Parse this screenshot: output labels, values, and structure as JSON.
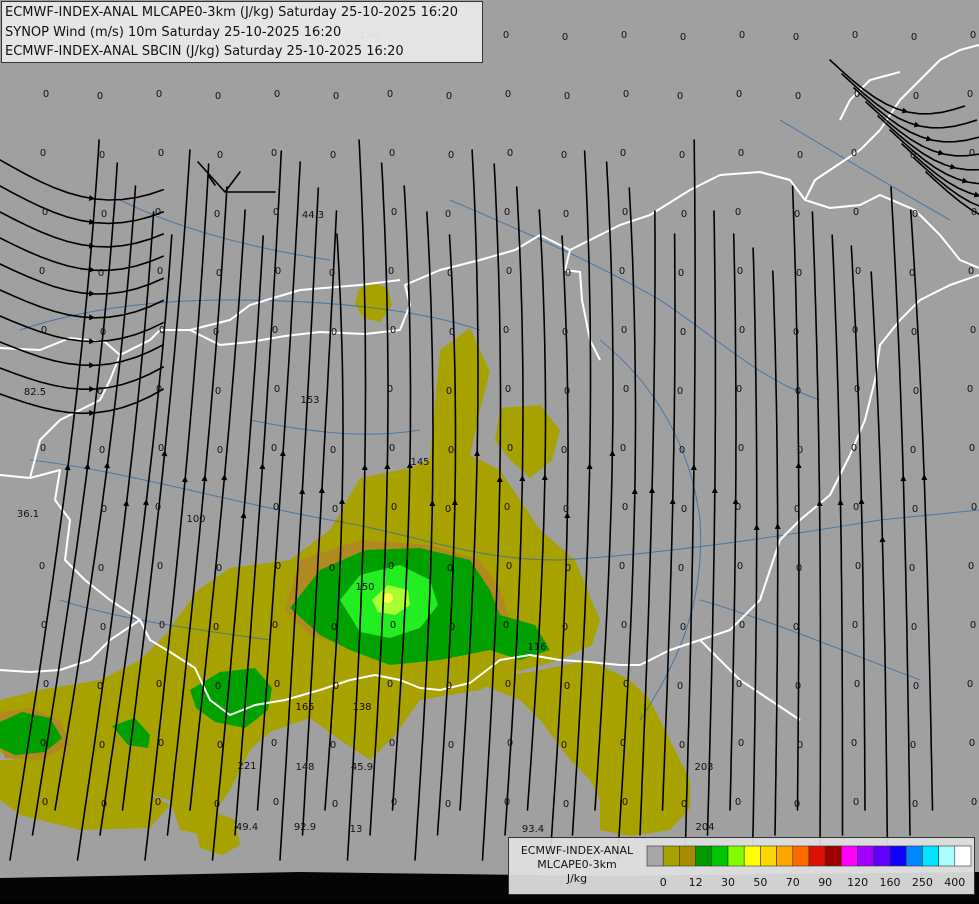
{
  "titles": [
    "ECMWF-INDEX-ANAL MLCAPE0-3km (J/kg) Saturday 25-10-2025 16:20",
    "SYNOP Wind (m/s) 10m Saturday 25-10-2025 16:20",
    "ECMWF-INDEX-ANAL SBCIN (J/kg) Saturday 25-10-2025 16:20"
  ],
  "legend": {
    "model": "ECMWF-INDEX-ANAL",
    "parameter": "MLCAPE0-3km",
    "unit": "J/kg",
    "tick_labels": [
      "0",
      "12",
      "30",
      "50",
      "70",
      "90",
      "120",
      "160",
      "250",
      "400"
    ],
    "colors": [
      "#a8a8a8",
      "#a7a200",
      "#a68d00",
      "#009a00",
      "#00c800",
      "#7fff00",
      "#ffff00",
      "#ffd700",
      "#ffa500",
      "#ff6a00",
      "#e01000",
      "#a00000",
      "#ff00ff",
      "#a000ff",
      "#6000ff",
      "#1000ff",
      "#0088ff",
      "#00e5ff",
      "#aaffff",
      "#ffffff"
    ]
  },
  "colors": {
    "background": "#a0a0a0",
    "border": "#ffffff",
    "river": "#3c6fa8",
    "streamline": "#000000",
    "cape_low": "#a7a200",
    "cape_edge": "#b08a20",
    "cape_mid": "#00a000",
    "cape_bright": "#22ee22",
    "cape_peak": "#aaff33"
  },
  "map_labels": [
    "1.66",
    "0",
    "0",
    "0",
    "0",
    "0",
    "0",
    "0",
    "0",
    "0",
    "0",
    "0",
    "44.3",
    "153",
    "82.5",
    "36.1",
    "100",
    "145",
    "153",
    "150",
    "165",
    "138",
    "221",
    "148",
    "45.9",
    "49.4",
    "92.9",
    "13",
    "93.4",
    "204",
    "203",
    "116",
    "0"
  ]
}
